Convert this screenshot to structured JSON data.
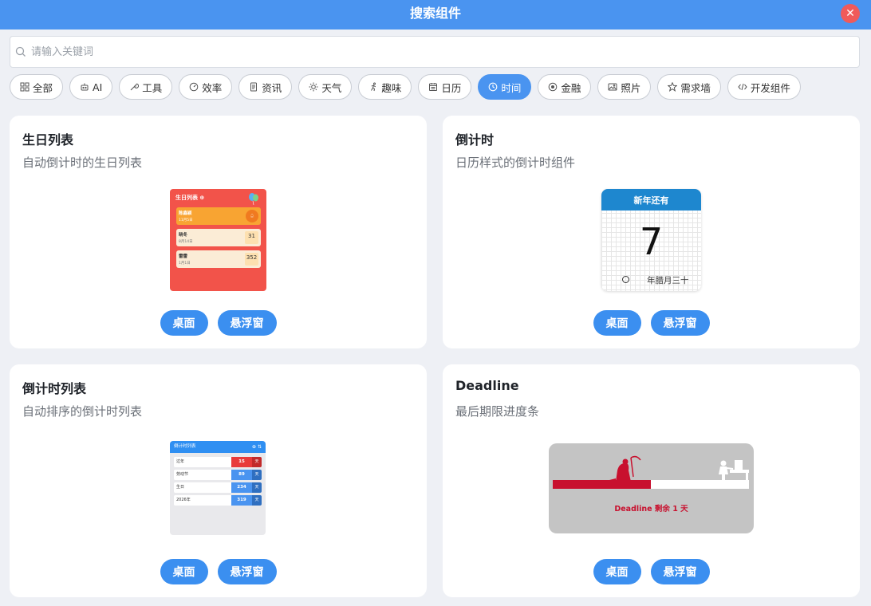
{
  "window": {
    "title": "搜索组件",
    "close_glyph": "✕"
  },
  "search": {
    "placeholder": "请输入关键词",
    "value": ""
  },
  "tabs": [
    {
      "label": "全部",
      "icon": "grid-icon",
      "active": false
    },
    {
      "label": "AI",
      "icon": "robot-icon",
      "active": false
    },
    {
      "label": "工具",
      "icon": "wrench-icon",
      "active": false
    },
    {
      "label": "效率",
      "icon": "gauge-icon",
      "active": false
    },
    {
      "label": "资讯",
      "icon": "document-icon",
      "active": false
    },
    {
      "label": "天气",
      "icon": "sun-icon",
      "active": false
    },
    {
      "label": "趣味",
      "icon": "running-icon",
      "active": false
    },
    {
      "label": "日历",
      "icon": "calendar-icon",
      "active": false
    },
    {
      "label": "时间",
      "icon": "clock-icon",
      "active": true
    },
    {
      "label": "金融",
      "icon": "coin-icon",
      "active": false
    },
    {
      "label": "照片",
      "icon": "image-icon",
      "active": false
    },
    {
      "label": "需求墙",
      "icon": "star-icon",
      "active": false
    },
    {
      "label": "开发组件",
      "icon": "code-icon",
      "active": false
    }
  ],
  "cards": [
    {
      "title": "生日列表",
      "desc": "自动倒计时的生日列表",
      "buttons": {
        "desktop": "桌面",
        "floating": "悬浮窗"
      },
      "preview": {
        "header": "生日列表 ⊕",
        "items": [
          {
            "name": "陈鑫颖",
            "date": "11月5日",
            "badge": ""
          },
          {
            "name": "晓冬",
            "date": "8月14日",
            "badge": "31"
          },
          {
            "name": "雷雷",
            "date": "1月1日",
            "badge": "352"
          }
        ]
      }
    },
    {
      "title": "倒计时",
      "desc": "日历样式的倒计时组件",
      "buttons": {
        "desktop": "桌面",
        "floating": "悬浮窗"
      },
      "preview": {
        "header": "新年还有",
        "number": "7",
        "lunar": "年腊月三十"
      }
    },
    {
      "title": "倒计时列表",
      "desc": "自动排序的倒计时列表",
      "buttons": {
        "desktop": "桌面",
        "floating": "悬浮窗"
      },
      "preview": {
        "header": "倒计时列表",
        "header_icons": "⊕ ⇅",
        "items": [
          {
            "name": "过年",
            "value": "15",
            "unit": "天",
            "hot": true
          },
          {
            "name": "劳动节",
            "value": "89",
            "unit": "天",
            "hot": false
          },
          {
            "name": "生日",
            "value": "234",
            "unit": "天",
            "hot": false
          },
          {
            "name": "2026年",
            "value": "319",
            "unit": "天",
            "hot": false
          }
        ]
      }
    },
    {
      "title": "Deadline",
      "desc": "最后期限进度条",
      "buttons": {
        "desktop": "桌面",
        "floating": "悬浮窗"
      },
      "preview": {
        "label": "Deadline 剩余 1 天",
        "progress": 0.5
      }
    }
  ],
  "colors": {
    "accent": "#4a94f0",
    "close": "#f05a5a",
    "deadline_red": "#c8102e",
    "bday_red": "#f2534a"
  }
}
